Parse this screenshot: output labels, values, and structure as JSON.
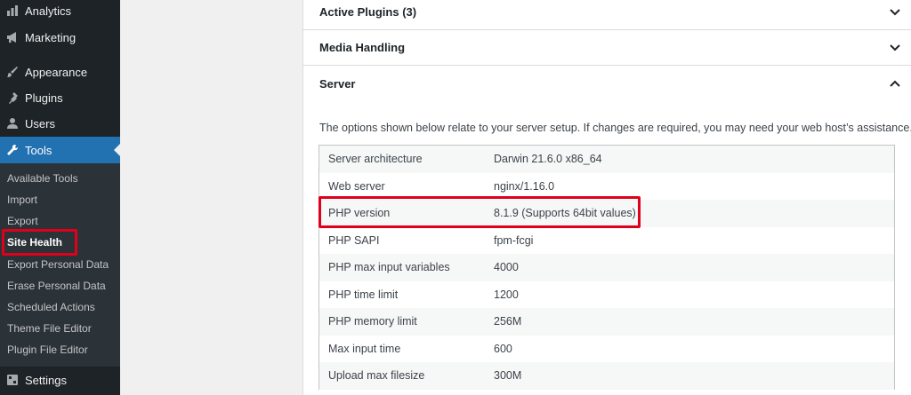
{
  "sidebar": {
    "menu": [
      {
        "label": "Analytics",
        "icon": "analytics-icon"
      },
      {
        "label": "Marketing",
        "icon": "megaphone-icon"
      },
      {
        "label": "Appearance",
        "icon": "paintbrush-icon"
      },
      {
        "label": "Plugins",
        "icon": "plug-icon"
      },
      {
        "label": "Users",
        "icon": "user-icon"
      },
      {
        "label": "Tools",
        "icon": "wrench-icon"
      },
      {
        "label": "Settings",
        "icon": "settings-icon"
      }
    ],
    "submenu": [
      "Available Tools",
      "Import",
      "Export",
      "Site Health",
      "Export Personal Data",
      "Erase Personal Data",
      "Scheduled Actions",
      "Theme File Editor",
      "Plugin File Editor"
    ]
  },
  "colors": {
    "sidebar_bg": "#1d2327",
    "active_bg": "#2271b1",
    "highlight": "#e0001b"
  },
  "main": {
    "sections": [
      {
        "title": "Active Plugins (3)",
        "expanded": false
      },
      {
        "title": "Media Handling",
        "expanded": false
      },
      {
        "title": "Server",
        "expanded": true
      }
    ],
    "description": "The options shown below relate to your server setup. If changes are required, you may need your web host’s assistance.",
    "server_rows": [
      {
        "key": "Server architecture",
        "value": "Darwin 21.6.0 x86_64"
      },
      {
        "key": "Web server",
        "value": "nginx/1.16.0"
      },
      {
        "key": "PHP version",
        "value": "8.1.9 (Supports 64bit values)"
      },
      {
        "key": "PHP SAPI",
        "value": "fpm-fcgi"
      },
      {
        "key": "PHP max input variables",
        "value": "4000"
      },
      {
        "key": "PHP time limit",
        "value": "1200"
      },
      {
        "key": "PHP memory limit",
        "value": "256M"
      },
      {
        "key": "Max input time",
        "value": "600"
      },
      {
        "key": "Upload max filesize",
        "value": "300M"
      }
    ]
  }
}
